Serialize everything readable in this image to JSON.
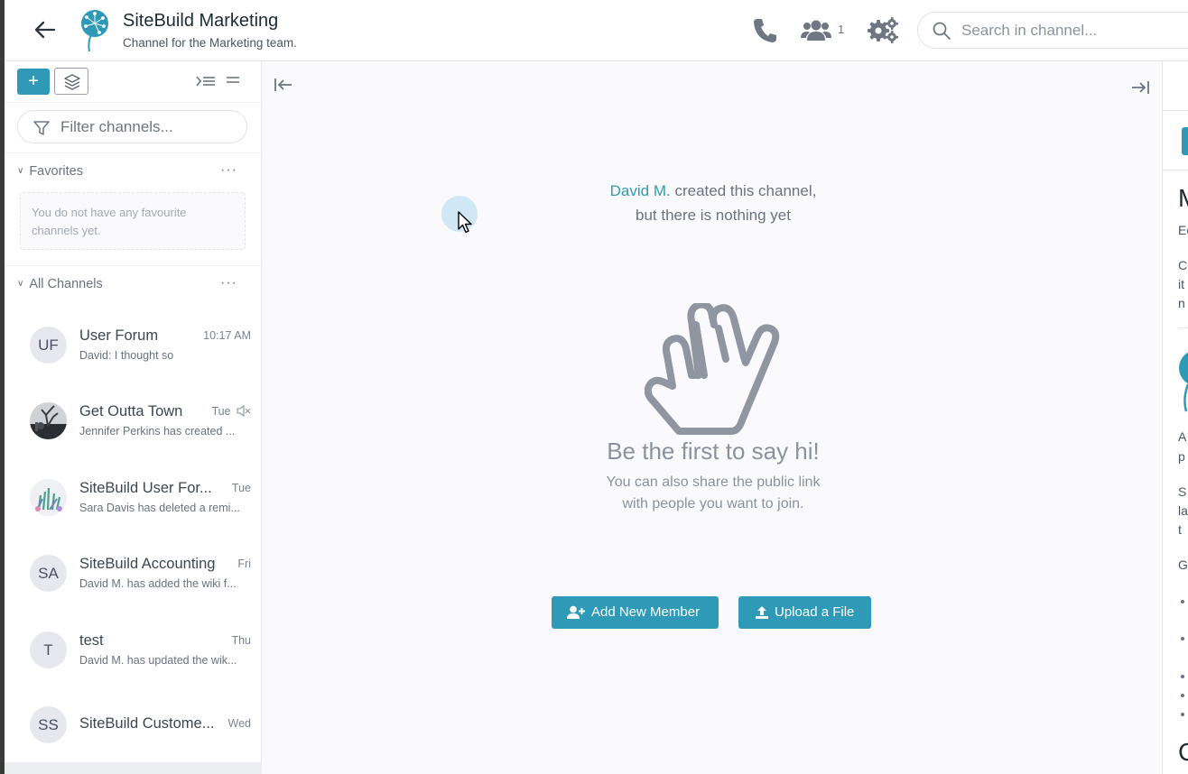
{
  "colors": {
    "accent": "#2e9ab8",
    "muted_text": "#8a929e",
    "main_bg": "#fafafc"
  },
  "header": {
    "title": "SiteBuild Marketing",
    "subtitle": "Channel for the Marketing team.",
    "member_count": "1",
    "search_placeholder": "Search in channel..."
  },
  "sidebar": {
    "filter_placeholder": "Filter channels...",
    "favorites": {
      "label": "Favorites",
      "empty_text": "You do not have any favourite channels yet."
    },
    "all_channels": {
      "label": "All Channels",
      "items": [
        {
          "initials": "UF",
          "name": "User Forum",
          "time": "10:17 AM",
          "last_message": "David: I thought so"
        },
        {
          "initials": "",
          "name": "Get Outta Town",
          "time": "Tue",
          "last_message": "Jennifer Perkins has created ...",
          "muted_icon": "mute-icon"
        },
        {
          "initials": "",
          "name": "SiteBuild User For...",
          "time": "Tue",
          "last_message": "Sara Davis has deleted a remi..."
        },
        {
          "initials": "SA",
          "name": "SiteBuild Accounting",
          "time": "Fri",
          "last_message": "David M. has added the wiki f..."
        },
        {
          "initials": "T",
          "name": "test",
          "time": "Thu",
          "last_message": "David M. has updated the wik..."
        },
        {
          "initials": "SS",
          "name": "SiteBuild Custome...",
          "time": "Wed",
          "last_message": ""
        }
      ]
    }
  },
  "main": {
    "creator": "David M.",
    "created_text": " created this channel,",
    "nothing_yet": "but there is nothing yet",
    "headline": "Be the first to say hi!",
    "share_line1": "You can also share the public link",
    "share_line2": "with people you want to join.",
    "add_member_label": "Add New Member",
    "upload_label": "Upload a File"
  },
  "right_panel": {
    "heading_fragment": "M",
    "lines": [
      "Ec",
      "C",
      "it",
      "n",
      "A",
      "p",
      "S",
      "la",
      "t",
      "G"
    ],
    "bottom_fragment": "C"
  }
}
